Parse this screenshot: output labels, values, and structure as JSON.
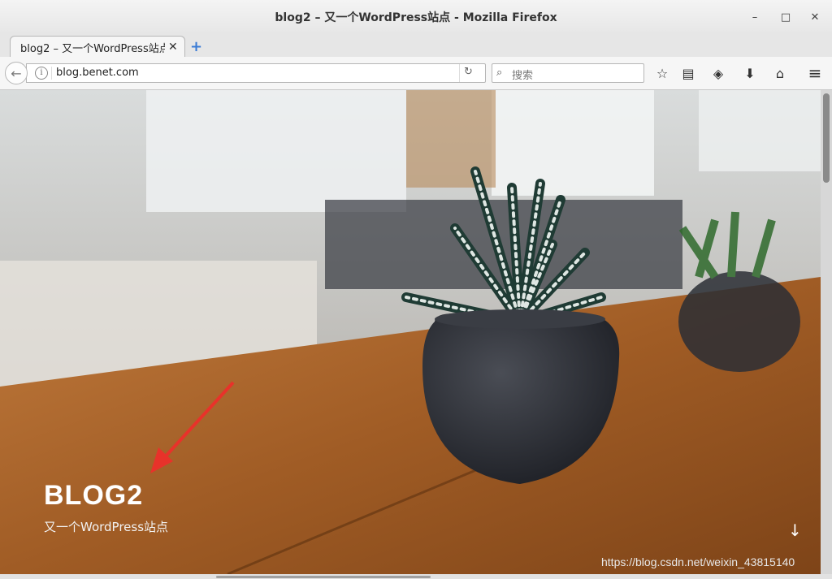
{
  "window": {
    "title": "blog2 – 又一个WordPress站点  -  Mozilla Firefox",
    "minimize": "–",
    "maximize": "□",
    "close": "✕"
  },
  "tabs": [
    {
      "label": "blog2 – 又一个WordPress站点",
      "close": "✕"
    }
  ],
  "new_tab": "+",
  "nav": {
    "back": "←",
    "info": "i",
    "url": "blog.benet.com",
    "reload": "↻",
    "search_icon": "⌕",
    "search_placeholder": "搜索",
    "bookmark": "☆",
    "reader": "▤",
    "pocket": "◈",
    "download": "⬇",
    "home": "⌂",
    "menu": "≡"
  },
  "page": {
    "site_title": "BLOG2",
    "site_tagline": "又一个WordPress站点",
    "scroll_down": "↓",
    "watermark": "https://blog.csdn.net/weixin_43815140"
  }
}
